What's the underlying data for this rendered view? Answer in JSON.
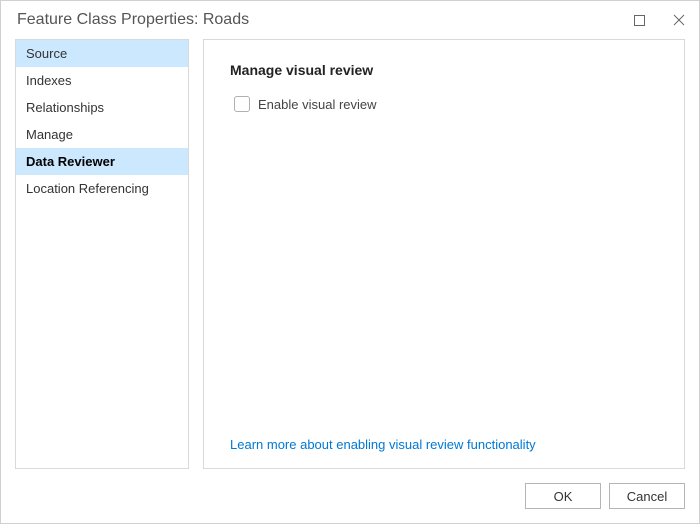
{
  "window": {
    "title": "Feature Class Properties: Roads"
  },
  "sidebar": {
    "items": [
      {
        "label": "Source",
        "highlight": true,
        "selected": false
      },
      {
        "label": "Indexes",
        "highlight": false,
        "selected": false
      },
      {
        "label": "Relationships",
        "highlight": false,
        "selected": false
      },
      {
        "label": "Manage",
        "highlight": false,
        "selected": false
      },
      {
        "label": "Data Reviewer",
        "highlight": true,
        "selected": true
      },
      {
        "label": "Location Referencing",
        "highlight": false,
        "selected": false
      }
    ]
  },
  "main": {
    "section_title": "Manage visual review",
    "checkbox_label": "Enable visual review",
    "help_link": "Learn more about enabling visual review functionality"
  },
  "buttons": {
    "ok": "OK",
    "cancel": "Cancel"
  }
}
